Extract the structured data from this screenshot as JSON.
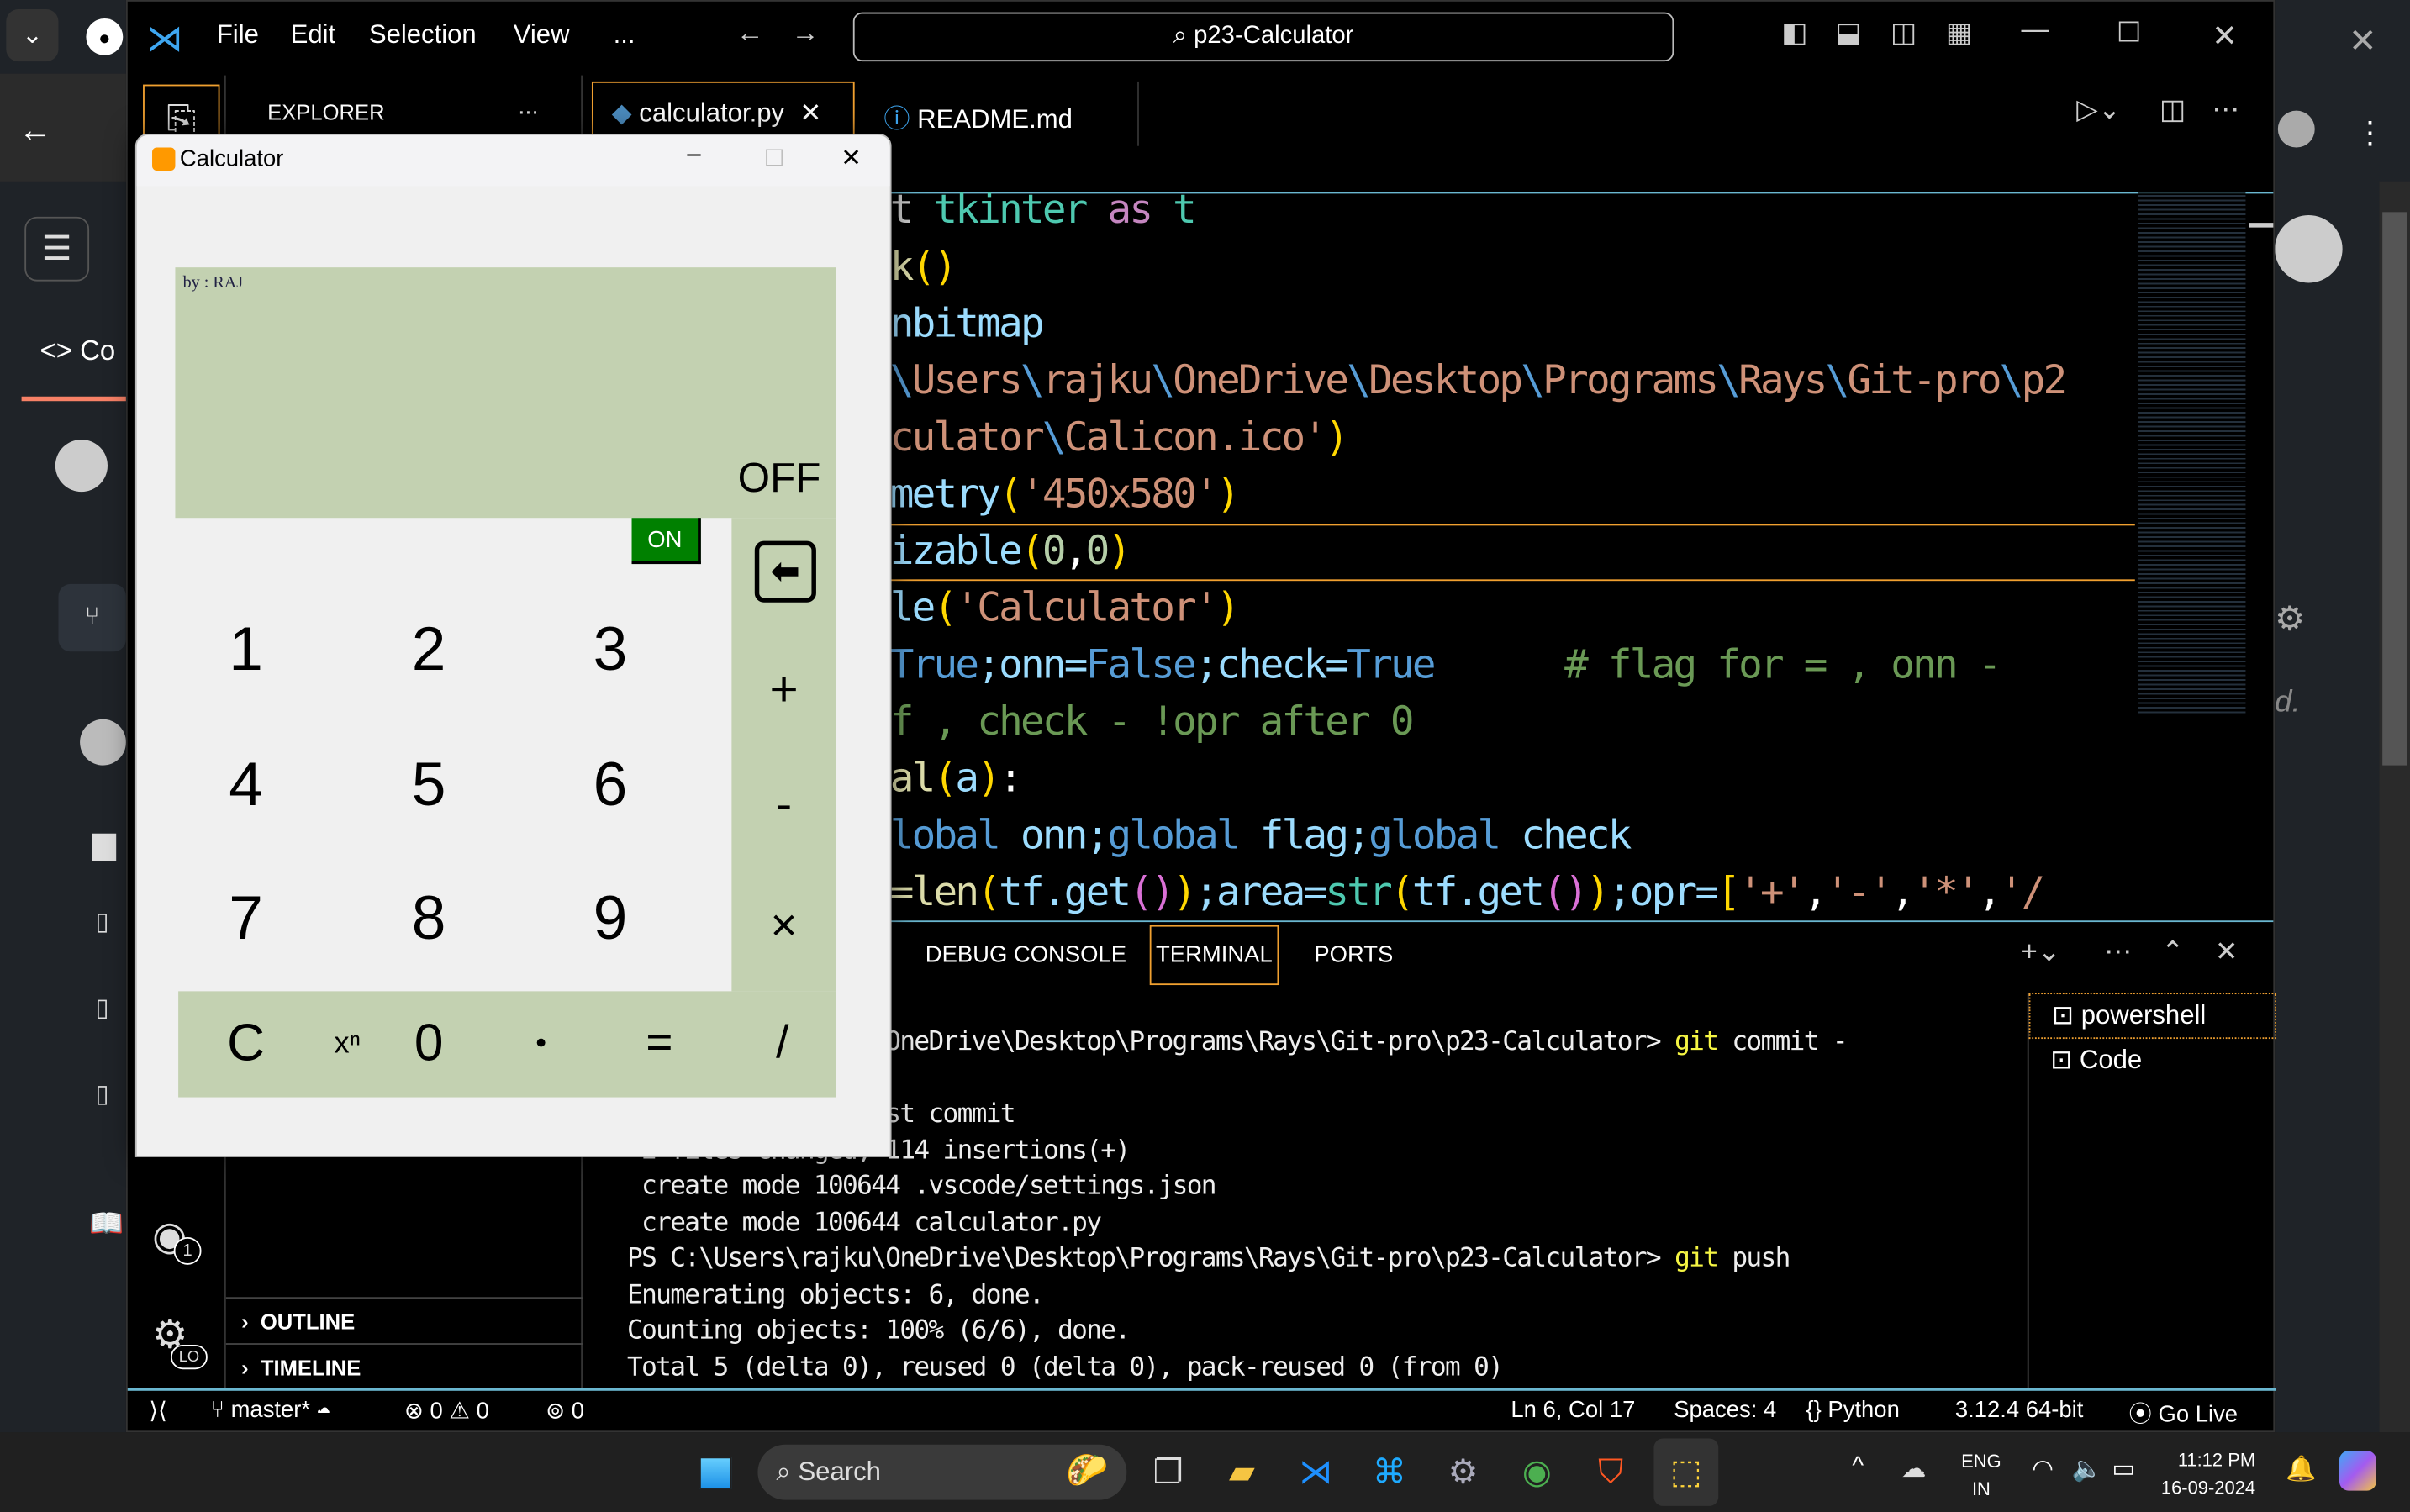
{
  "browser": {
    "left_label": "Co",
    "right_italic": "d."
  },
  "vscode": {
    "menu": [
      "File",
      "Edit",
      "Selection",
      "View",
      "..."
    ],
    "search": "p23-Calculator",
    "tabs": [
      {
        "label": "calculator.py",
        "active": true
      },
      {
        "label": "README.md",
        "active": false
      }
    ],
    "explorer": {
      "title": "EXPLORER",
      "more": "...",
      "outline": "OUTLINE",
      "timeline": "TIMELINE"
    },
    "account_badge": "1",
    "settings_badge": "LO",
    "code_lines": [
      [
        [
          "t ",
          "#cccccc"
        ],
        [
          "tkinter",
          "#4ec9b0"
        ],
        [
          " ",
          "#fff"
        ],
        [
          "as",
          "#c586c0"
        ],
        [
          " ",
          "#fff"
        ],
        [
          "t",
          "#4ec9b0"
        ]
      ],
      [
        [
          "k",
          "#dcdcaa"
        ],
        [
          "()",
          "#ffd700"
        ]
      ],
      [
        [
          "nbitmap",
          "#9cdcfe"
        ]
      ],
      [
        [
          "\\",
          "#569cd6"
        ],
        [
          "Users",
          "#ce9178"
        ],
        [
          "\\",
          "#569cd6"
        ],
        [
          "rajku",
          "#ce9178"
        ],
        [
          "\\",
          "#569cd6"
        ],
        [
          "OneDrive",
          "#ce9178"
        ],
        [
          "\\",
          "#569cd6"
        ],
        [
          "Desktop",
          "#ce9178"
        ],
        [
          "\\",
          "#569cd6"
        ],
        [
          "Programs",
          "#ce9178"
        ],
        [
          "\\",
          "#569cd6"
        ],
        [
          "Rays",
          "#ce9178"
        ],
        [
          "\\",
          "#569cd6"
        ],
        [
          "Git-pro",
          "#ce9178"
        ],
        [
          "\\",
          "#569cd6"
        ],
        [
          "p2",
          "#ce9178"
        ]
      ],
      [
        [
          "culator",
          "#ce9178"
        ],
        [
          "\\",
          "#569cd6"
        ],
        [
          "Calicon.ico'",
          "#ce9178"
        ],
        [
          ")",
          "#ffd700"
        ]
      ],
      [
        [
          "metry",
          "#9cdcfe"
        ],
        [
          "(",
          "#ffd700"
        ],
        [
          "'450x580'",
          "#ce9178"
        ],
        [
          ")",
          "#ffd700"
        ]
      ],
      [
        [
          "izable",
          "#9cdcfe"
        ],
        [
          "(",
          "#ffd700"
        ],
        [
          "0",
          "#b5cea8"
        ],
        [
          ",",
          "#fff"
        ],
        [
          "0",
          "#b5cea8"
        ],
        [
          ")",
          "#ffd700"
        ]
      ],
      [
        [
          "le",
          "#9cdcfe"
        ],
        [
          "(",
          "#ffd700"
        ],
        [
          "'Calculator'",
          "#ce9178"
        ],
        [
          ")",
          "#ffd700"
        ]
      ],
      [
        [
          "True",
          "#569cd6"
        ],
        [
          ";onn=",
          "#9cdcfe"
        ],
        [
          "False",
          "#569cd6"
        ],
        [
          ";check=",
          "#9cdcfe"
        ],
        [
          "True",
          "#569cd6"
        ],
        [
          "      # flag for = , onn -",
          "#6a9955"
        ]
      ],
      [
        [
          "f , check - !opr after 0",
          "#6a9955"
        ]
      ],
      [
        [
          "al",
          "#dcdcaa"
        ],
        [
          "(",
          "#ffd700"
        ],
        [
          "a",
          "#9cdcfe"
        ],
        [
          ")",
          "#ffd700"
        ],
        [
          ":",
          "#fff"
        ]
      ],
      [
        [
          "lobal",
          "#569cd6"
        ],
        [
          " onn;",
          "#9cdcfe"
        ],
        [
          "global",
          "#569cd6"
        ],
        [
          " flag;",
          "#9cdcfe"
        ],
        [
          "global",
          "#569cd6"
        ],
        [
          " check",
          "#9cdcfe"
        ]
      ],
      [
        [
          "=len",
          "#dcdcaa"
        ],
        [
          "(",
          "#ffd700"
        ],
        [
          "tf.get",
          "#9cdcfe"
        ],
        [
          "()",
          "#da70d6"
        ],
        [
          ")",
          "#ffd700"
        ],
        [
          ";area=",
          "#9cdcfe"
        ],
        [
          "str",
          "#4ec9b0"
        ],
        [
          "(",
          "#ffd700"
        ],
        [
          "tf.get",
          "#9cdcfe"
        ],
        [
          "()",
          "#da70d6"
        ],
        [
          ")",
          "#ffd700"
        ],
        [
          ";opr=",
          "#9cdcfe"
        ],
        [
          "[",
          "#ffd700"
        ],
        [
          "'+'",
          "#ce9178"
        ],
        [
          ",",
          "#fff"
        ],
        [
          "'-'",
          "#ce9178"
        ],
        [
          ",",
          "#fff"
        ],
        [
          "'*'",
          "#ce9178"
        ],
        [
          ",",
          "#fff"
        ],
        [
          "'/",
          "#ce9178"
        ]
      ]
    ],
    "panel_tabs": [
      "DEBUG CONSOLE",
      "TERMINAL",
      "PORTS"
    ],
    "terminal_lines": [
      [
        [
          "PS C:\\Users\\rajku\\OneDrive\\Desktop\\Programs\\Rays\\Git-pro\\p23-Calculator> ",
          "#eee"
        ],
        [
          "git",
          "#f5f543"
        ],
        [
          " commit -",
          "#eee"
        ]
      ],
      [
        [
          "",
          "#eee"
        ]
      ],
      [
        [
          "                 rst commit",
          "#eee"
        ]
      ],
      [
        [
          " 2 files changed, 114 insertions(+)",
          "#eee"
        ]
      ],
      [
        [
          " create mode 100644 .vscode/settings.json",
          "#eee"
        ]
      ],
      [
        [
          " create mode 100644 calculator.py",
          "#eee"
        ]
      ],
      [
        [
          "PS C:\\Users\\rajku\\OneDrive\\Desktop\\Programs\\Rays\\Git-pro\\p23-Calculator> ",
          "#eee"
        ],
        [
          "git",
          "#f5f543"
        ],
        [
          " push",
          "#eee"
        ]
      ],
      [
        [
          "Enumerating objects: 6, done.",
          "#eee"
        ]
      ],
      [
        [
          "Counting objects: 100% (6/6), done.",
          "#eee"
        ]
      ],
      [
        [
          "Total 5 (delta 0), reused 0 (delta 0), pack-reused 0 (from 0)",
          "#eee"
        ]
      ]
    ],
    "terminals": [
      "powershell",
      "Code"
    ],
    "status": {
      "branch": "master*",
      "errors": "0",
      "warnings": "0",
      "ports": "0",
      "position": "Ln 6, Col 17",
      "spaces": "Spaces: 4",
      "language": "Python",
      "interpreter": "3.12.4 64-bit",
      "golive": "Go Live"
    }
  },
  "calculator": {
    "title": "Calculator",
    "author": "by : RAJ",
    "display": "OFF",
    "on_label": "ON",
    "digits": [
      "1",
      "2",
      "3",
      "4",
      "5",
      "6",
      "7",
      "8",
      "9"
    ],
    "ops": [
      "+",
      "-",
      "×"
    ],
    "bottom": [
      "C",
      "xⁿ",
      "0",
      "•",
      "=",
      "/"
    ]
  },
  "taskbar": {
    "search": "Search",
    "lang1": "ENG",
    "lang2": "IN",
    "time": "11:12 PM",
    "date": "16-09-2024"
  },
  "colors": {
    "accent": "#f0a030",
    "calc_green": "#c3d1b1",
    "on_green": "#008000"
  }
}
